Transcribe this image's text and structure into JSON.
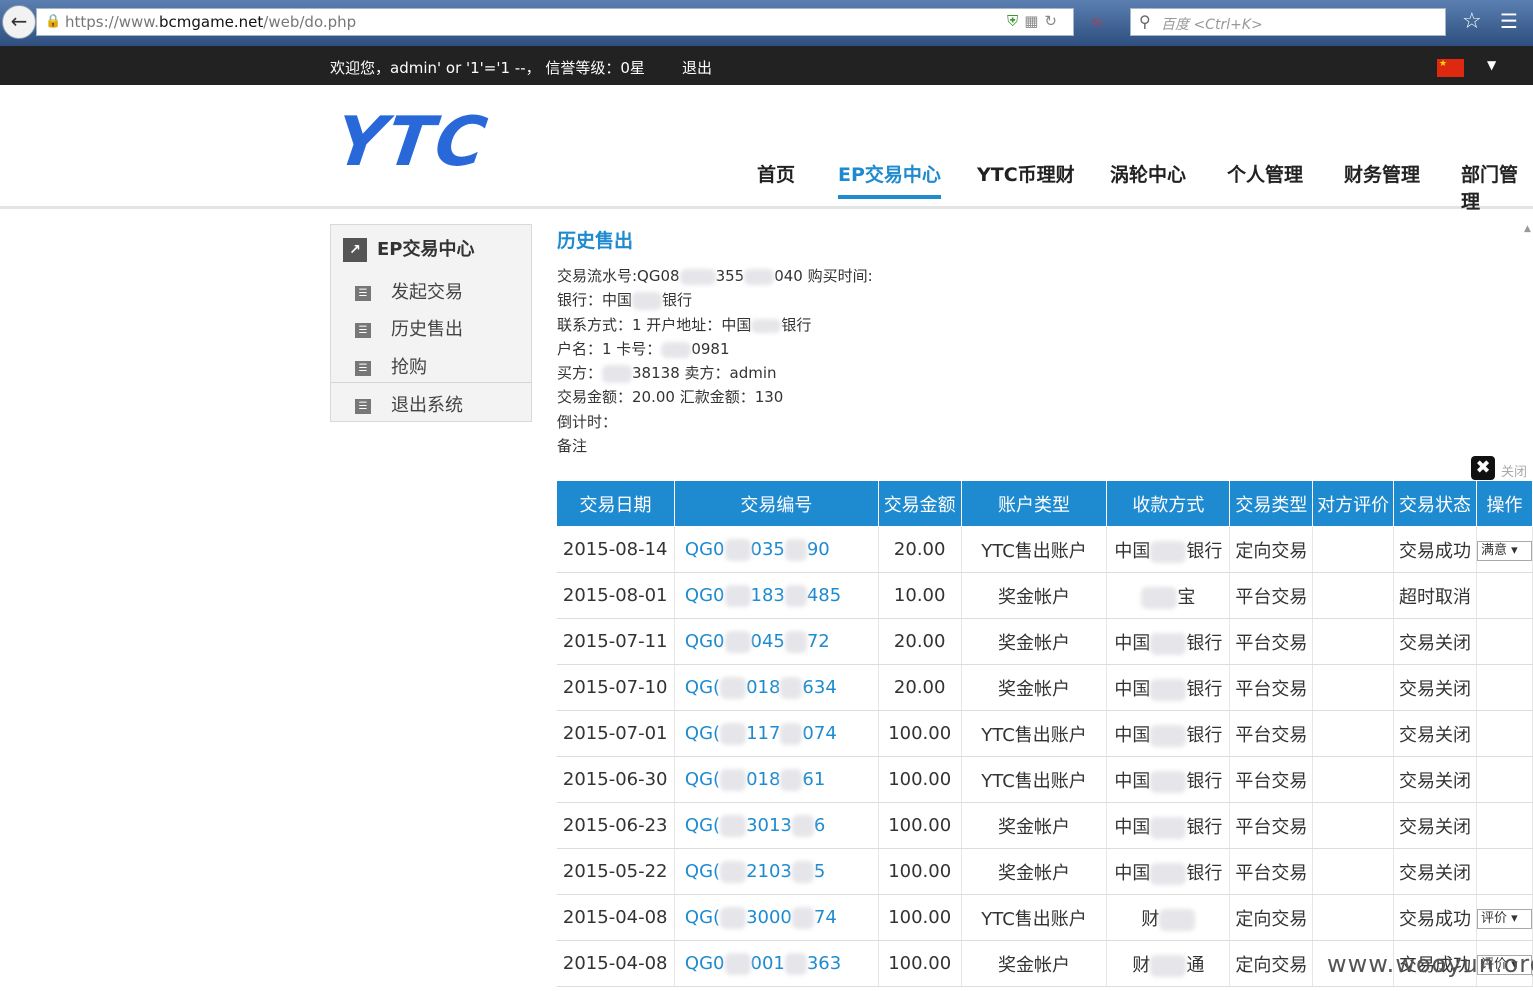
{
  "browser": {
    "url_prefix": "https://www.",
    "url_domain": "bcmgame.net",
    "url_path": "/web/do.php",
    "search_placeholder": "百度 <Ctrl+K>"
  },
  "topbar": {
    "welcome": "欢迎您，admin' or '1'='1 --， 信誉等级：0星",
    "logout": "退出"
  },
  "header": {
    "logo": "YTC",
    "nav": [
      "首页",
      "EP交易中心",
      "YTC币理财",
      "涡轮中心",
      "个人管理",
      "财务管理",
      "部门管理"
    ]
  },
  "sidebar": {
    "title": "EP交易中心",
    "items": [
      "发起交易",
      "历史售出",
      "抢购",
      "退出系统"
    ]
  },
  "main": {
    "title": "历史售出",
    "detail": {
      "line1": "交易流水号:QG08",
      "line1b": "355",
      "line1c": "040 购买时间:",
      "line2a": "银行：中国",
      "line2b": "银行",
      "line3a": "联系方式：1 开户地址：中国",
      "line3b": "银行",
      "line4a": "户名：1 卡号：",
      "line4b": "0981",
      "line5a": "买方：",
      "line5b": "38138 卖方：admin",
      "line6": "交易金额：20.00 汇款金额：130",
      "line7": "倒计时：",
      "line8": "备注"
    },
    "close_label": "关闭"
  },
  "table": {
    "headers": [
      "交易日期",
      "交易编号",
      "交易金额",
      "账户类型",
      "收款方式",
      "交易类型",
      "对方评价",
      "交易状态",
      "操作"
    ],
    "rows": [
      {
        "date": "2015-08-14",
        "code_a": "QG0",
        "code_b": "035",
        "code_c": "90",
        "amount": "20.00",
        "acct": "YTC售出账户",
        "pay_a": "中国",
        "pay_b": "银行",
        "type": "定向交易",
        "review": "",
        "status": "交易成功",
        "op": "满意"
      },
      {
        "date": "2015-08-01",
        "code_a": "QG0",
        "code_b": "183",
        "code_c": "485",
        "amount": "10.00",
        "acct": "奖金帐户",
        "pay_a": "",
        "pay_b": "宝",
        "type": "平台交易",
        "review": "",
        "status": "超时取消",
        "op": ""
      },
      {
        "date": "2015-07-11",
        "code_a": "QG0",
        "code_b": "045",
        "code_c": "72",
        "amount": "20.00",
        "acct": "奖金帐户",
        "pay_a": "中国",
        "pay_b": "银行",
        "type": "平台交易",
        "review": "",
        "status": "交易关闭",
        "op": ""
      },
      {
        "date": "2015-07-10",
        "code_a": "QG(",
        "code_b": "018",
        "code_c": "634",
        "amount": "20.00",
        "acct": "奖金帐户",
        "pay_a": "中国",
        "pay_b": "银行",
        "type": "平台交易",
        "review": "",
        "status": "交易关闭",
        "op": ""
      },
      {
        "date": "2015-07-01",
        "code_a": "QG(",
        "code_b": "117",
        "code_c": "074",
        "amount": "100.00",
        "acct": "YTC售出账户",
        "pay_a": "中国",
        "pay_b": "银行",
        "type": "平台交易",
        "review": "",
        "status": "交易关闭",
        "op": ""
      },
      {
        "date": "2015-06-30",
        "code_a": "QG(",
        "code_b": "018",
        "code_c": "61",
        "amount": "100.00",
        "acct": "YTC售出账户",
        "pay_a": "中国",
        "pay_b": "银行",
        "type": "平台交易",
        "review": "",
        "status": "交易关闭",
        "op": ""
      },
      {
        "date": "2015-06-23",
        "code_a": "QG(",
        "code_b": "3013",
        "code_c": "6",
        "amount": "100.00",
        "acct": "奖金帐户",
        "pay_a": "中国",
        "pay_b": "银行",
        "type": "平台交易",
        "review": "",
        "status": "交易关闭",
        "op": ""
      },
      {
        "date": "2015-05-22",
        "code_a": "QG(",
        "code_b": "2103",
        "code_c": "5",
        "amount": "100.00",
        "acct": "奖金帐户",
        "pay_a": "中国",
        "pay_b": "银行",
        "type": "平台交易",
        "review": "",
        "status": "交易关闭",
        "op": ""
      },
      {
        "date": "2015-04-08",
        "code_a": "QG(",
        "code_b": "3000",
        "code_c": "74",
        "amount": "100.00",
        "acct": "YTC售出账户",
        "pay_a": "财",
        "pay_b": "",
        "type": "定向交易",
        "review": "",
        "status": "交易成功",
        "op": "评价"
      },
      {
        "date": "2015-04-08",
        "code_a": "QG0",
        "code_b": "001",
        "code_c": "363",
        "amount": "100.00",
        "acct": "奖金帐户",
        "pay_a": "财",
        "pay_b": "通",
        "type": "定向交易",
        "review": "",
        "status": "交易成功",
        "op": "评价"
      }
    ]
  },
  "watermark": "www.wooyun.org",
  "colors": {
    "accent": "#1e8ad0",
    "logo": "#2968d8",
    "topbar": "#222222"
  }
}
